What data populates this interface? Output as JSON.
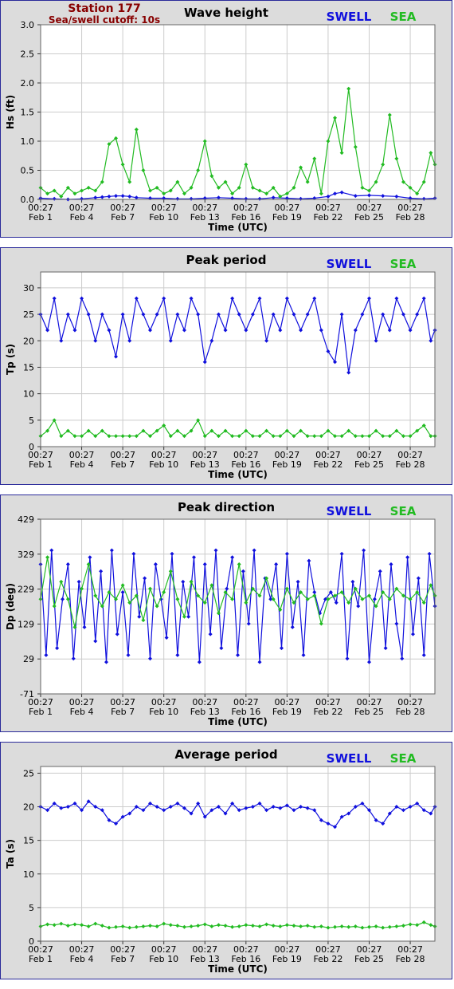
{
  "station": {
    "name": "Station 177",
    "cutoff": "Sea/swell cutoff: 10s"
  },
  "legend": {
    "swell": "SWELL",
    "sea": "SEA"
  },
  "colors": {
    "swell": "#1010dd",
    "sea": "#22bb22",
    "station": "#880000",
    "plot_bg": "#ffffff",
    "panel_bg": "#dcdcdc",
    "grid": "#cccccc"
  },
  "x_axis": {
    "xlabel": "Time (UTC)",
    "days": [
      1,
      4,
      7,
      10,
      13,
      16,
      19,
      22,
      25,
      28
    ],
    "tick_times": [
      "00:27",
      "00:27",
      "00:27",
      "00:27",
      "00:27",
      "00:27",
      "00:27",
      "00:27",
      "00:27",
      "00:27"
    ],
    "tick_dates": [
      "Feb 1",
      "Feb 4",
      "Feb 7",
      "Feb 10",
      "Feb 13",
      "Feb 16",
      "Feb 19",
      "Feb 22",
      "Feb 25",
      "Feb 28"
    ],
    "xlim": [
      1,
      29.8
    ]
  },
  "chart_data": [
    {
      "type": "line",
      "title": "Wave height",
      "ylabel": "Hs (ft)",
      "ylim": [
        0,
        3.0
      ],
      "yticks": [
        "0.0",
        "0.5",
        "1.0",
        "1.5",
        "2.0",
        "2.5",
        "3.0"
      ],
      "ytick_values": [
        0,
        0.5,
        1.0,
        1.5,
        2.0,
        2.5,
        3.0
      ],
      "series": [
        {
          "name": "SWELL",
          "x": [
            1,
            2,
            3,
            4,
            5,
            5.5,
            6,
            6.5,
            7,
            7.5,
            8,
            9,
            10,
            11,
            12,
            13,
            14,
            15,
            16,
            17,
            18,
            19,
            20,
            21,
            22,
            22.5,
            23,
            24,
            25,
            26,
            27,
            28,
            29,
            29.8
          ],
          "y": [
            0.02,
            0.01,
            0.0,
            0.01,
            0.03,
            0.04,
            0.05,
            0.06,
            0.06,
            0.05,
            0.03,
            0.02,
            0.02,
            0.01,
            0.01,
            0.02,
            0.03,
            0.02,
            0.01,
            0.01,
            0.03,
            0.02,
            0.01,
            0.02,
            0.05,
            0.1,
            0.12,
            0.06,
            0.07,
            0.06,
            0.05,
            0.02,
            0.01,
            0.02
          ]
        },
        {
          "name": "SEA",
          "x": [
            1,
            1.5,
            2,
            2.5,
            3,
            3.5,
            4,
            4.5,
            5,
            5.5,
            6,
            6.5,
            7,
            7.5,
            8,
            8.5,
            9,
            9.5,
            10,
            10.5,
            11,
            11.5,
            12,
            12.5,
            13,
            13.5,
            14,
            14.5,
            15,
            15.5,
            16,
            16.5,
            17,
            17.5,
            18,
            18.5,
            19,
            19.5,
            20,
            20.5,
            21,
            21.5,
            22,
            22.5,
            23,
            23.5,
            24,
            24.5,
            25,
            25.5,
            26,
            26.5,
            27,
            27.5,
            28,
            28.5,
            29,
            29.5,
            29.8
          ],
          "y": [
            0.2,
            0.1,
            0.15,
            0.05,
            0.2,
            0.1,
            0.15,
            0.2,
            0.15,
            0.3,
            0.95,
            1.05,
            0.6,
            0.3,
            1.2,
            0.5,
            0.15,
            0.2,
            0.1,
            0.15,
            0.3,
            0.1,
            0.2,
            0.5,
            1.0,
            0.4,
            0.2,
            0.3,
            0.1,
            0.2,
            0.6,
            0.2,
            0.15,
            0.1,
            0.2,
            0.05,
            0.1,
            0.2,
            0.55,
            0.3,
            0.7,
            0.1,
            1.0,
            1.4,
            0.8,
            1.9,
            0.9,
            0.2,
            0.15,
            0.3,
            0.6,
            1.45,
            0.7,
            0.3,
            0.2,
            0.1,
            0.3,
            0.8,
            0.6
          ]
        }
      ]
    },
    {
      "type": "line",
      "title": "Peak period",
      "ylabel": "Tp (s)",
      "ylim": [
        0,
        33
      ],
      "yticks": [
        "0",
        "5",
        "10",
        "15",
        "20",
        "25",
        "30"
      ],
      "ytick_values": [
        0,
        5,
        10,
        15,
        20,
        25,
        30
      ],
      "series": [
        {
          "name": "SWELL",
          "x": [
            1,
            1.5,
            2,
            2.5,
            3,
            3.5,
            4,
            4.5,
            5,
            5.5,
            6,
            6.5,
            7,
            7.5,
            8,
            8.5,
            9,
            9.5,
            10,
            10.5,
            11,
            11.5,
            12,
            12.5,
            13,
            13.5,
            14,
            14.5,
            15,
            15.5,
            16,
            16.5,
            17,
            17.5,
            18,
            18.5,
            19,
            19.5,
            20,
            20.5,
            21,
            21.5,
            22,
            22.5,
            23,
            23.5,
            24,
            24.5,
            25,
            25.5,
            26,
            26.5,
            27,
            27.5,
            28,
            28.5,
            29,
            29.5,
            29.8
          ],
          "y": [
            25,
            22,
            28,
            20,
            25,
            22,
            28,
            25,
            20,
            25,
            22,
            17,
            25,
            20,
            28,
            25,
            22,
            25,
            28,
            20,
            25,
            22,
            28,
            25,
            16,
            20,
            25,
            22,
            28,
            25,
            22,
            25,
            28,
            20,
            25,
            22,
            28,
            25,
            22,
            25,
            28,
            22,
            18,
            16,
            25,
            14,
            22,
            25,
            28,
            20,
            25,
            22,
            28,
            25,
            22,
            25,
            28,
            20,
            22
          ]
        },
        {
          "name": "SEA",
          "x": [
            1,
            1.5,
            2,
            2.5,
            3,
            3.5,
            4,
            4.5,
            5,
            5.5,
            6,
            6.5,
            7,
            7.5,
            8,
            8.5,
            9,
            9.5,
            10,
            10.5,
            11,
            11.5,
            12,
            12.5,
            13,
            13.5,
            14,
            14.5,
            15,
            15.5,
            16,
            16.5,
            17,
            17.5,
            18,
            18.5,
            19,
            19.5,
            20,
            20.5,
            21,
            21.5,
            22,
            22.5,
            23,
            23.5,
            24,
            24.5,
            25,
            25.5,
            26,
            26.5,
            27,
            27.5,
            28,
            28.5,
            29,
            29.5,
            29.8
          ],
          "y": [
            2,
            3,
            5,
            2,
            3,
            2,
            2,
            3,
            2,
            3,
            2,
            2,
            2,
            2,
            2,
            3,
            2,
            3,
            4,
            2,
            3,
            2,
            3,
            5,
            2,
            3,
            2,
            3,
            2,
            2,
            3,
            2,
            2,
            3,
            2,
            2,
            3,
            2,
            3,
            2,
            2,
            2,
            3,
            2,
            2,
            3,
            2,
            2,
            2,
            3,
            2,
            2,
            3,
            2,
            2,
            3,
            4,
            2,
            2
          ]
        }
      ]
    },
    {
      "type": "line",
      "title": "Peak direction",
      "ylabel": "Dp (deg)",
      "ylim": [
        -71,
        429
      ],
      "yticks": [
        "-71",
        "29",
        "129",
        "229",
        "329",
        "429"
      ],
      "ytick_values": [
        -71,
        29,
        129,
        229,
        329,
        429
      ],
      "series": [
        {
          "name": "SWELL",
          "x": [
            1,
            1.4,
            1.8,
            2.2,
            2.6,
            3,
            3.4,
            3.8,
            4.2,
            4.6,
            5,
            5.4,
            5.8,
            6.2,
            6.6,
            7,
            7.4,
            7.8,
            8.2,
            8.6,
            9,
            9.4,
            9.8,
            10.2,
            10.6,
            11,
            11.4,
            11.8,
            12.2,
            12.6,
            13,
            13.4,
            13.8,
            14.2,
            14.6,
            15,
            15.4,
            15.8,
            16.2,
            16.6,
            17,
            17.4,
            17.8,
            18.2,
            18.6,
            19,
            19.4,
            19.8,
            20.2,
            20.6,
            21,
            21.4,
            21.8,
            22.2,
            22.6,
            23,
            23.4,
            23.8,
            24.2,
            24.6,
            25,
            25.4,
            25.8,
            26.2,
            26.6,
            27,
            27.4,
            27.8,
            28.2,
            28.6,
            29,
            29.4,
            29.8
          ],
          "y": [
            300,
            40,
            340,
            60,
            200,
            300,
            30,
            250,
            120,
            320,
            80,
            280,
            20,
            340,
            100,
            220,
            40,
            330,
            150,
            260,
            30,
            300,
            200,
            90,
            330,
            40,
            250,
            150,
            320,
            20,
            300,
            100,
            340,
            60,
            230,
            320,
            40,
            280,
            130,
            340,
            20,
            260,
            200,
            300,
            60,
            330,
            120,
            250,
            40,
            310,
            220,
            160,
            200,
            220,
            190,
            330,
            30,
            250,
            180,
            340,
            20,
            200,
            280,
            60,
            300,
            130,
            30,
            320,
            100,
            260,
            40,
            330,
            180
          ]
        },
        {
          "name": "SEA",
          "x": [
            1,
            1.5,
            2,
            2.5,
            3,
            3.5,
            4,
            4.5,
            5,
            5.5,
            6,
            6.5,
            7,
            7.5,
            8,
            8.5,
            9,
            9.5,
            10,
            10.5,
            11,
            11.5,
            12,
            12.5,
            13,
            13.5,
            14,
            14.5,
            15,
            15.5,
            16,
            16.5,
            17,
            17.5,
            18,
            18.5,
            19,
            19.5,
            20,
            20.5,
            21,
            21.5,
            22,
            22.5,
            23,
            23.5,
            24,
            24.5,
            25,
            25.5,
            26,
            26.5,
            27,
            27.5,
            28,
            28.5,
            29,
            29.5,
            29.8
          ],
          "y": [
            200,
            320,
            180,
            250,
            200,
            120,
            230,
            300,
            210,
            180,
            220,
            200,
            240,
            190,
            210,
            140,
            230,
            180,
            220,
            280,
            200,
            150,
            250,
            210,
            190,
            240,
            160,
            220,
            200,
            300,
            190,
            230,
            210,
            260,
            200,
            170,
            230,
            190,
            220,
            200,
            210,
            130,
            200,
            210,
            220,
            190,
            230,
            200,
            210,
            180,
            220,
            200,
            230,
            210,
            200,
            220,
            190,
            240,
            210
          ]
        }
      ]
    },
    {
      "type": "line",
      "title": "Average period",
      "ylabel": "Ta (s)",
      "ylim": [
        0,
        26
      ],
      "yticks": [
        "0",
        "5",
        "10",
        "15",
        "20",
        "25"
      ],
      "ytick_values": [
        0,
        5,
        10,
        15,
        20,
        25
      ],
      "series": [
        {
          "name": "SWELL",
          "x": [
            1,
            1.5,
            2,
            2.5,
            3,
            3.5,
            4,
            4.5,
            5,
            5.5,
            6,
            6.5,
            7,
            7.5,
            8,
            8.5,
            9,
            9.5,
            10,
            10.5,
            11,
            11.5,
            12,
            12.5,
            13,
            13.5,
            14,
            14.5,
            15,
            15.5,
            16,
            16.5,
            17,
            17.5,
            18,
            18.5,
            19,
            19.5,
            20,
            20.5,
            21,
            21.5,
            22,
            22.5,
            23,
            23.5,
            24,
            24.5,
            25,
            25.5,
            26,
            26.5,
            27,
            27.5,
            28,
            28.5,
            29,
            29.5,
            29.8
          ],
          "y": [
            20,
            19.5,
            20.5,
            19.8,
            20,
            20.5,
            19.5,
            20.8,
            20,
            19.5,
            18,
            17.5,
            18.5,
            19,
            20,
            19.5,
            20.5,
            20,
            19.5,
            20,
            20.5,
            19.8,
            19,
            20.5,
            18.5,
            19.5,
            20,
            19,
            20.5,
            19.5,
            19.8,
            20,
            20.5,
            19.5,
            20,
            19.8,
            20.2,
            19.5,
            20,
            19.8,
            19.5,
            18,
            17.5,
            17,
            18.5,
            19,
            20,
            20.5,
            19.5,
            18,
            17.5,
            19,
            20,
            19.5,
            20,
            20.5,
            19.5,
            19,
            20
          ]
        },
        {
          "name": "SEA",
          "x": [
            1,
            1.5,
            2,
            2.5,
            3,
            3.5,
            4,
            4.5,
            5,
            5.5,
            6,
            6.5,
            7,
            7.5,
            8,
            8.5,
            9,
            9.5,
            10,
            10.5,
            11,
            11.5,
            12,
            12.5,
            13,
            13.5,
            14,
            14.5,
            15,
            15.5,
            16,
            16.5,
            17,
            17.5,
            18,
            18.5,
            19,
            19.5,
            20,
            20.5,
            21,
            21.5,
            22,
            22.5,
            23,
            23.5,
            24,
            24.5,
            25,
            25.5,
            26,
            26.5,
            27,
            27.5,
            28,
            28.5,
            29,
            29.5,
            29.8
          ],
          "y": [
            2.2,
            2.5,
            2.4,
            2.6,
            2.3,
            2.5,
            2.4,
            2.2,
            2.6,
            2.3,
            2.0,
            2.1,
            2.2,
            2.0,
            2.1,
            2.2,
            2.3,
            2.2,
            2.6,
            2.4,
            2.3,
            2.1,
            2.2,
            2.3,
            2.5,
            2.2,
            2.4,
            2.3,
            2.1,
            2.2,
            2.4,
            2.3,
            2.2,
            2.5,
            2.3,
            2.2,
            2.4,
            2.3,
            2.2,
            2.3,
            2.1,
            2.2,
            2.0,
            2.1,
            2.2,
            2.1,
            2.2,
            2.0,
            2.1,
            2.2,
            2.0,
            2.1,
            2.2,
            2.3,
            2.5,
            2.4,
            2.8,
            2.4,
            2.2
          ]
        }
      ]
    }
  ]
}
